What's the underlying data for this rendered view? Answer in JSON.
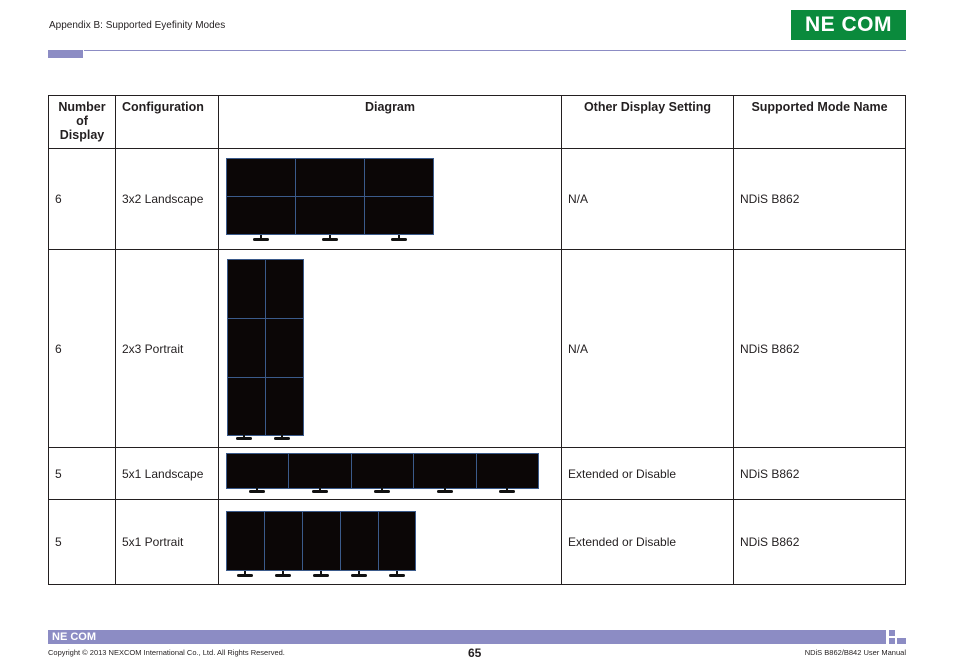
{
  "header": {
    "section_title": "Appendix B: Supported Eyefinity Modes",
    "logo_text": "NE COM",
    "brand_color": "#0a8a3c",
    "accent_color": "#8c8cc4"
  },
  "table": {
    "headers": [
      "Number of Display",
      "Configuration",
      "Diagram",
      "Other Display Setting",
      "Supported Mode Name"
    ],
    "rows": [
      {
        "number": "6",
        "configuration": "3x2 Landscape",
        "diagram": "3x2 landscape monitor arrangement",
        "other": "N/A",
        "mode": "NDiS B862"
      },
      {
        "number": "6",
        "configuration": "2x3 Portrait",
        "diagram": "2x3 portrait monitor arrangement",
        "other": "N/A",
        "mode": "NDiS B862"
      },
      {
        "number": "5",
        "configuration": "5x1 Landscape",
        "diagram": "5x1 landscape monitor arrangement",
        "other": "Extended or Disable",
        "mode": "NDiS B862"
      },
      {
        "number": "5",
        "configuration": "5x1 Portrait",
        "diagram": "5x1 portrait monitor arrangement",
        "other": "Extended or Disable",
        "mode": "NDiS B862"
      }
    ]
  },
  "footer": {
    "logo_text": "NE COM",
    "copyright": "Copyright © 2013 NEXCOM International Co., Ltd. All Rights Reserved.",
    "page_number": "65",
    "manual_name": "NDiS B862/B842 User Manual"
  }
}
